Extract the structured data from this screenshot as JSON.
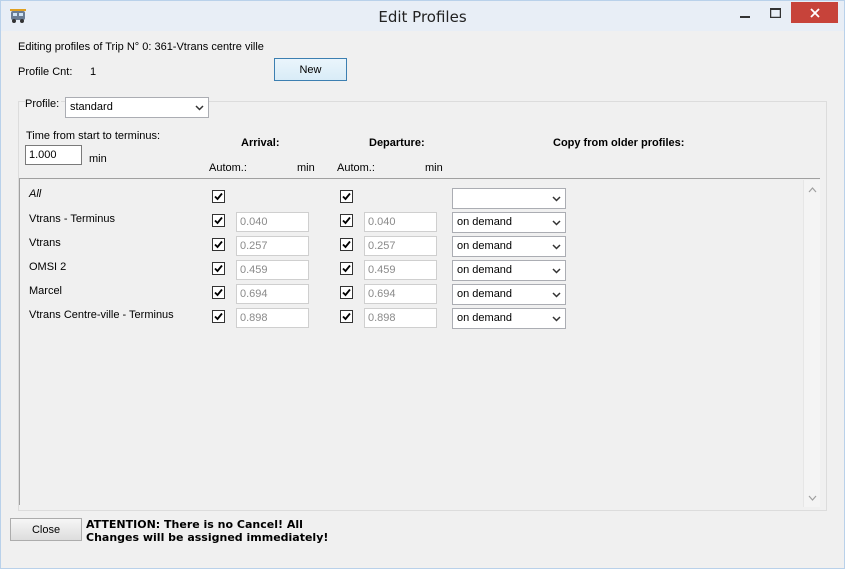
{
  "window": {
    "title": "Edit Profiles"
  },
  "header": {
    "editing_text": "Editing profiles of Trip N° 0: 361-Vtrans centre ville",
    "profile_cnt_label": "Profile Cnt:",
    "profile_cnt_value": "1",
    "new_button": "New"
  },
  "profile": {
    "label": "Profile:",
    "selected": "standard"
  },
  "time": {
    "label": "Time from start to terminus:",
    "value": "1.000",
    "unit": "min"
  },
  "columns": {
    "arrival": "Arrival:",
    "departure": "Departure:",
    "copy": "Copy from older profiles:",
    "autom": "Autom.:",
    "min": "min"
  },
  "rows": [
    {
      "label": "All",
      "arr_checked": true,
      "arr_value": "",
      "dep_checked": true,
      "dep_value": "",
      "copy": ""
    },
    {
      "label": "Vtrans - Terminus",
      "arr_checked": true,
      "arr_value": "0.040",
      "dep_checked": true,
      "dep_value": "0.040",
      "copy": "on demand"
    },
    {
      "label": "Vtrans",
      "arr_checked": true,
      "arr_value": "0.257",
      "dep_checked": true,
      "dep_value": "0.257",
      "copy": "on demand"
    },
    {
      "label": "OMSI 2",
      "arr_checked": true,
      "arr_value": "0.459",
      "dep_checked": true,
      "dep_value": "0.459",
      "copy": "on demand"
    },
    {
      "label": "Marcel",
      "arr_checked": true,
      "arr_value": "0.694",
      "dep_checked": true,
      "dep_value": "0.694",
      "copy": "on demand"
    },
    {
      "label": "Vtrans Centre-ville - Terminus",
      "arr_checked": true,
      "arr_value": "0.898",
      "dep_checked": true,
      "dep_value": "0.898",
      "copy": "on demand"
    }
  ],
  "footer": {
    "close_button": "Close",
    "attention_line1": "ATTENTION: There is no Cancel! All",
    "attention_line2": "Changes will be assigned immediately!"
  },
  "icons": {
    "app": "bus-icon",
    "minimize": "minimize-icon",
    "maximize": "maximize-icon",
    "close": "close-icon"
  },
  "colors": {
    "close_button_bg": "#c7433a",
    "title_bar": "#e8eef6",
    "window_bg": "#f0f0f0"
  }
}
